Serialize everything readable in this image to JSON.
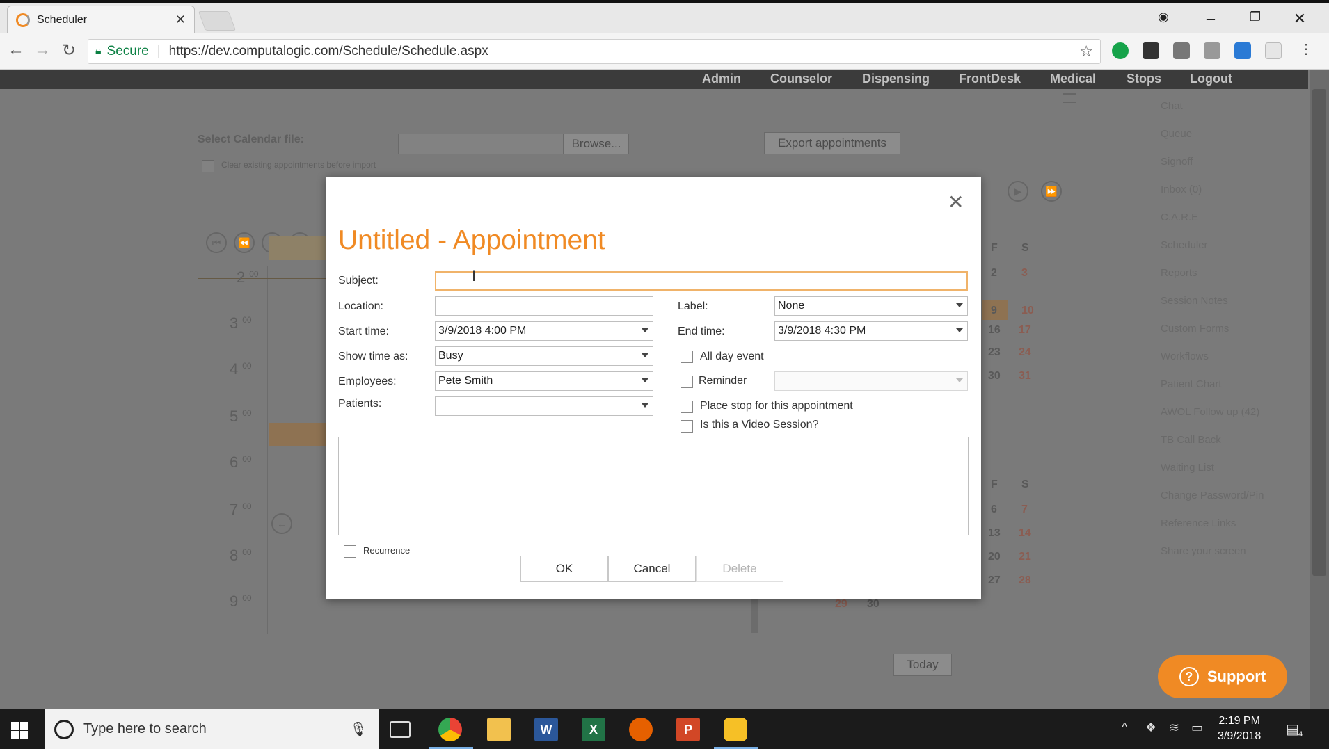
{
  "browser": {
    "tab_title": "Scheduler",
    "secure_label": "Secure",
    "url": "https://dev.computalogic.com/Schedule/Schedule.aspx"
  },
  "topnav": {
    "items": [
      "Admin",
      "Counselor",
      "Dispensing",
      "FrontDesk",
      "Medical",
      "Stops",
      "Logout"
    ]
  },
  "background": {
    "select_calendar_label": "Select Calendar file:",
    "browse_label": "Browse...",
    "export_label": "Export appointments",
    "clear_existing_label": "Clear existing appointments before import",
    "hours": [
      "2",
      "3",
      "4",
      "5",
      "6",
      "7",
      "8",
      "9"
    ],
    "hour_minutes": "00",
    "cal_header_f": "F",
    "cal_header_s": "S",
    "cal_top": [
      [
        "2",
        "3"
      ],
      [
        "9",
        "10"
      ],
      [
        "16",
        "17"
      ],
      [
        "23",
        "24"
      ],
      [
        "30",
        "31"
      ]
    ],
    "cal_bottom": [
      [
        "6",
        "7"
      ],
      [
        "13",
        "14"
      ],
      [
        "20",
        "21"
      ],
      [
        "27",
        "28"
      ]
    ],
    "cal_extra": [
      "29",
      "30"
    ],
    "today_label": "Today",
    "side_links": [
      "Chat",
      "Queue",
      "Signoff",
      "Inbox (0)",
      "C.A.R.E",
      "Scheduler",
      "Reports",
      "Session Notes",
      "Custom Forms",
      "Workflows",
      "Patient Chart",
      "AWOL Follow up (42)",
      "TB Call Back",
      "Waiting List",
      "Change Password/Pin",
      "Reference Links",
      "Share your screen"
    ]
  },
  "modal": {
    "title": "Untitled - Appointment",
    "subject_label": "Subject:",
    "subject_value": "",
    "location_label": "Location:",
    "location_value": "",
    "label_label": "Label:",
    "label_value": "None",
    "start_label": "Start time:",
    "start_value": "3/9/2018 4:00 PM",
    "end_label": "End time:",
    "end_value": "3/9/2018 4:30 PM",
    "show_time_label": "Show time as:",
    "show_time_value": "Busy",
    "all_day_label": "All day event",
    "employees_label": "Employees:",
    "employees_value": "Pete Smith",
    "reminder_label": "Reminder",
    "patients_label": "Patients:",
    "patients_value": "",
    "place_stop_label": "Place stop for this appointment",
    "video_label": "Is this a Video Session?",
    "recurrence_label": "Recurrence",
    "ok_label": "OK",
    "cancel_label": "Cancel",
    "delete_label": "Delete"
  },
  "support_label": "Support",
  "taskbar": {
    "search_placeholder": "Type here to search",
    "time": "2:19 PM",
    "date": "3/9/2018",
    "notif_count": "4"
  },
  "colors": {
    "accent": "#f08a24",
    "nav_bg": "#3b3b3b"
  }
}
